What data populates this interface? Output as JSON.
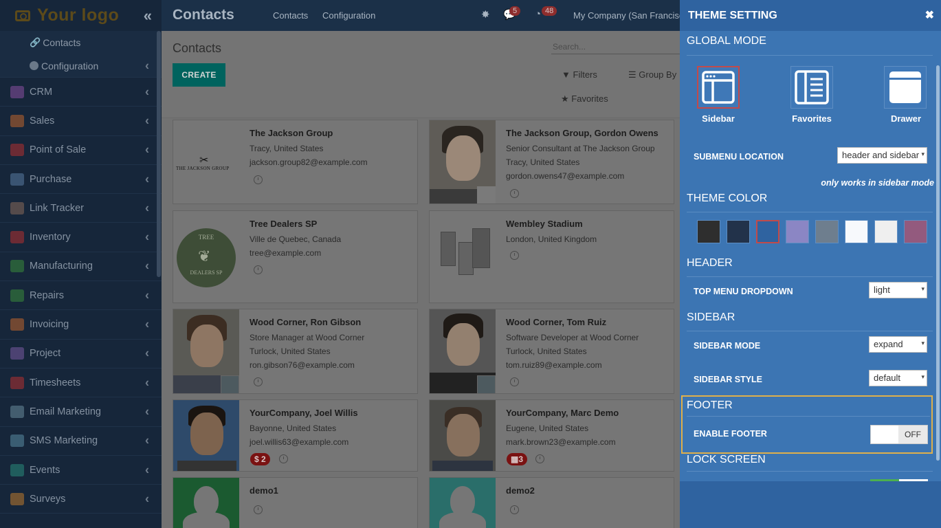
{
  "sidebar": {
    "logo": "Your logo",
    "sub_items": [
      {
        "label": "Contacts",
        "icon": "link-icon"
      },
      {
        "label": "Configuration",
        "icon": "circle-icon"
      }
    ],
    "menu": [
      {
        "label": "CRM",
        "color": "#8a4fa0"
      },
      {
        "label": "Sales",
        "color": "#c0642c"
      },
      {
        "label": "Point of Sale",
        "color": "#b53030"
      },
      {
        "label": "Purchase",
        "color": "#5a7aa0"
      },
      {
        "label": "Link Tracker",
        "color": "#8a6a5a"
      },
      {
        "label": "Inventory",
        "color": "#b53030"
      },
      {
        "label": "Manufacturing",
        "color": "#3a8a3a"
      },
      {
        "label": "Repairs",
        "color": "#3a8a3a"
      },
      {
        "label": "Invoicing",
        "color": "#c0642c"
      },
      {
        "label": "Project",
        "color": "#7a5aa0"
      },
      {
        "label": "Timesheets",
        "color": "#b53030"
      },
      {
        "label": "Email Marketing",
        "color": "#6a8a9a"
      },
      {
        "label": "SMS Marketing",
        "color": "#5a8aa0"
      },
      {
        "label": "Events",
        "color": "#2a8a7a"
      },
      {
        "label": "Surveys",
        "color": "#c07a2c"
      }
    ]
  },
  "header": {
    "title": "Contacts",
    "nav": [
      "Contacts",
      "Configuration"
    ],
    "messages_count": "5",
    "activities_count": "48",
    "company": "My Company (San Francisco)"
  },
  "control": {
    "breadcrumb": "Contacts",
    "create_label": "CREATE",
    "search_placeholder": "Search...",
    "filters_label": "Filters",
    "groupby_label": "Group By",
    "favorites_label": "Favorites"
  },
  "contacts": [
    {
      "name": "The Jackson Group",
      "lines": [
        "Tracy, United States",
        "jackson.group82@example.com"
      ],
      "logo_text": "THE JACKSON GROUP"
    },
    {
      "name": "The Jackson Group, Gordon Owens",
      "lines": [
        "Senior Consultant at The Jackson Group",
        "Tracy, United States",
        "gordon.owens47@example.com"
      ]
    },
    {
      "name": "Tree Dealers SP",
      "lines": [
        "Ville de Quebec, Canada",
        "tree@example.com"
      ],
      "logo_text_top": "TREE",
      "logo_text_bottom": "DEALERS SP"
    },
    {
      "name": "Wembley Stadium",
      "lines": [
        "London, United Kingdom"
      ]
    },
    {
      "name": "Wood Corner, Ron Gibson",
      "lines": [
        "Store Manager at Wood Corner",
        "Turlock, United States",
        "ron.gibson76@example.com"
      ]
    },
    {
      "name": "Wood Corner, Tom Ruiz",
      "lines": [
        "Software Developer at Wood Corner",
        "Turlock, United States",
        "tom.ruiz89@example.com"
      ]
    },
    {
      "name": "YourCompany, Joel Willis",
      "lines": [
        "Bayonne, United States",
        "joel.willis63@example.com"
      ],
      "badge": "$ 2"
    },
    {
      "name": "YourCompany, Marc Demo",
      "lines": [
        "Eugene, United States",
        "mark.brown23@example.com"
      ],
      "badge": "3"
    },
    {
      "name": "demo1",
      "lines": []
    },
    {
      "name": "demo2",
      "lines": []
    }
  ],
  "theme": {
    "title": "THEME SETTING",
    "global_mode": {
      "title": "GLOBAL MODE",
      "options": [
        "Sidebar",
        "Favorites",
        "Drawer"
      ],
      "selected": "Sidebar"
    },
    "submenu_location": {
      "label": "SUBMENU LOCATION",
      "value": "header and sidebar"
    },
    "sidebar_note": "only works in sidebar mode",
    "theme_color": {
      "title": "THEME COLOR",
      "colors": [
        "#2e2e2e",
        "#22324a",
        "#2f63a0",
        "#8b86c4",
        "#6e7e8e",
        "#f7f9fc",
        "#efefef",
        "#935a7e"
      ],
      "selected": "#2f63a0"
    },
    "header_section": {
      "title": "HEADER",
      "top_menu_label": "TOP MENU DROPDOWN",
      "top_menu_value": "light"
    },
    "sidebar_section": {
      "title": "SIDEBAR",
      "mode_label": "SIDEBAR MODE",
      "mode_value": "expand",
      "style_label": "SIDEBAR STYLE",
      "style_value": "default"
    },
    "footer_section": {
      "title": "FOOTER",
      "enable_label": "ENABLE FOOTER",
      "enable_value": "OFF"
    },
    "lock_section": {
      "title": "LOCK SCREEN"
    }
  }
}
